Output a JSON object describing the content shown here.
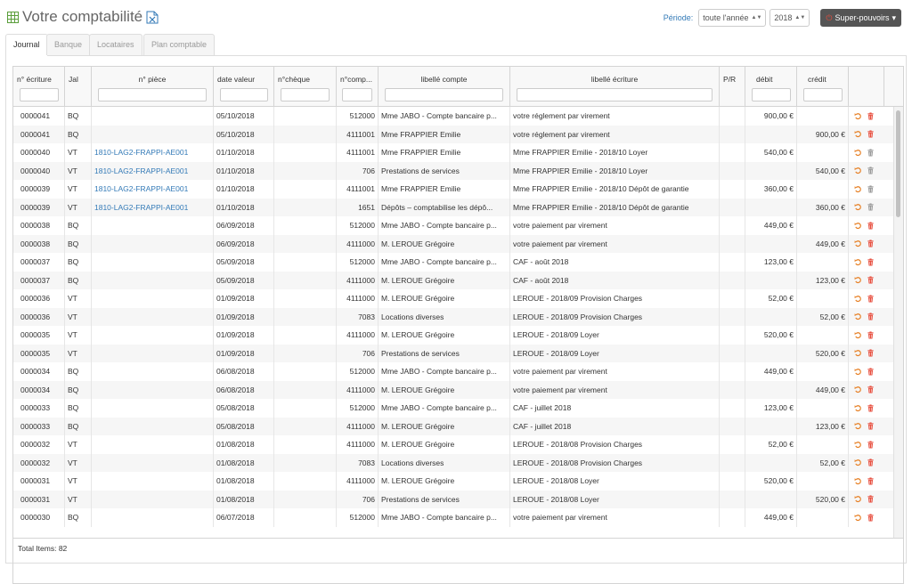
{
  "page": {
    "title": "Votre comptabilité"
  },
  "period": {
    "label": "Période:",
    "range": "toute l'année",
    "year": "2018"
  },
  "super": {
    "label": "Super-pouvoirs"
  },
  "tabs": [
    {
      "label": "Journal",
      "active": true
    },
    {
      "label": "Banque",
      "active": false
    },
    {
      "label": "Locataires",
      "active": false
    },
    {
      "label": "Plan comptable",
      "active": false
    }
  ],
  "columns": [
    "n° écriture",
    "Jal",
    "n° pièce",
    "date valeur",
    "n°chèque",
    "n°comp...",
    "libellé compte",
    "libellé écriture",
    "P/R",
    "débit",
    "crédit"
  ],
  "rows": [
    {
      "ecriture": "0000041",
      "jal": "BQ",
      "piece": "",
      "date": "05/10/2018",
      "cheque": "",
      "compte": "512000",
      "libcompte": "Mme JABO - Compte bancaire p...",
      "libecriture": "votre réglement par virement",
      "pr": "",
      "debit": "900,00 €",
      "credit": ""
    },
    {
      "ecriture": "0000041",
      "jal": "BQ",
      "piece": "",
      "date": "05/10/2018",
      "cheque": "",
      "compte": "4111001",
      "libcompte": "Mme FRAPPIER Emilie",
      "libecriture": "votre réglement par virement",
      "pr": "",
      "debit": "",
      "credit": "900,00 €"
    },
    {
      "ecriture": "0000040",
      "jal": "VT",
      "piece": "1810-LAG2-FRAPPI-AE001",
      "date": "01/10/2018",
      "cheque": "",
      "compte": "4111001",
      "libcompte": "Mme FRAPPIER Emilie",
      "libecriture": "Mme FRAPPIER Emilie - 2018/10 Loyer",
      "pr": "",
      "debit": "540,00 €",
      "credit": ""
    },
    {
      "ecriture": "0000040",
      "jal": "VT",
      "piece": "1810-LAG2-FRAPPI-AE001",
      "date": "01/10/2018",
      "cheque": "",
      "compte": "706",
      "libcompte": "Prestations de services",
      "libecriture": "Mme FRAPPIER Emilie - 2018/10 Loyer",
      "pr": "",
      "debit": "",
      "credit": "540,00 €"
    },
    {
      "ecriture": "0000039",
      "jal": "VT",
      "piece": "1810-LAG2-FRAPPI-AE001",
      "date": "01/10/2018",
      "cheque": "",
      "compte": "4111001",
      "libcompte": "Mme FRAPPIER Emilie",
      "libecriture": "Mme FRAPPIER Emilie - 2018/10 Dépôt de garantie",
      "pr": "",
      "debit": "360,00 €",
      "credit": ""
    },
    {
      "ecriture": "0000039",
      "jal": "VT",
      "piece": "1810-LAG2-FRAPPI-AE001",
      "date": "01/10/2018",
      "cheque": "",
      "compte": "1651",
      "libcompte": "Dépôts – comptabilise les dépô...",
      "libecriture": "Mme FRAPPIER Emilie - 2018/10 Dépôt de garantie",
      "pr": "",
      "debit": "",
      "credit": "360,00 €"
    },
    {
      "ecriture": "0000038",
      "jal": "BQ",
      "piece": "",
      "date": "06/09/2018",
      "cheque": "",
      "compte": "512000",
      "libcompte": "Mme JABO - Compte bancaire p...",
      "libecriture": "votre paiement par virement",
      "pr": "",
      "debit": "449,00 €",
      "credit": ""
    },
    {
      "ecriture": "0000038",
      "jal": "BQ",
      "piece": "",
      "date": "06/09/2018",
      "cheque": "",
      "compte": "4111000",
      "libcompte": "M. LEROUE Grégoire",
      "libecriture": "votre paiement par virement",
      "pr": "",
      "debit": "",
      "credit": "449,00 €"
    },
    {
      "ecriture": "0000037",
      "jal": "BQ",
      "piece": "",
      "date": "05/09/2018",
      "cheque": "",
      "compte": "512000",
      "libcompte": "Mme JABO - Compte bancaire p...",
      "libecriture": "CAF - août 2018",
      "pr": "",
      "debit": "123,00 €",
      "credit": ""
    },
    {
      "ecriture": "0000037",
      "jal": "BQ",
      "piece": "",
      "date": "05/09/2018",
      "cheque": "",
      "compte": "4111000",
      "libcompte": "M. LEROUE Grégoire",
      "libecriture": "CAF - août 2018",
      "pr": "",
      "debit": "",
      "credit": "123,00 €"
    },
    {
      "ecriture": "0000036",
      "jal": "VT",
      "piece": "",
      "date": "01/09/2018",
      "cheque": "",
      "compte": "4111000",
      "libcompte": "M. LEROUE Grégoire",
      "libecriture": "LEROUE - 2018/09 Provision Charges",
      "pr": "",
      "debit": "52,00 €",
      "credit": ""
    },
    {
      "ecriture": "0000036",
      "jal": "VT",
      "piece": "",
      "date": "01/09/2018",
      "cheque": "",
      "compte": "7083",
      "libcompte": "Locations diverses",
      "libecriture": "LEROUE - 2018/09 Provision Charges",
      "pr": "",
      "debit": "",
      "credit": "52,00 €"
    },
    {
      "ecriture": "0000035",
      "jal": "VT",
      "piece": "",
      "date": "01/09/2018",
      "cheque": "",
      "compte": "4111000",
      "libcompte": "M. LEROUE Grégoire",
      "libecriture": "LEROUE - 2018/09 Loyer",
      "pr": "",
      "debit": "520,00 €",
      "credit": ""
    },
    {
      "ecriture": "0000035",
      "jal": "VT",
      "piece": "",
      "date": "01/09/2018",
      "cheque": "",
      "compte": "706",
      "libcompte": "Prestations de services",
      "libecriture": "LEROUE - 2018/09 Loyer",
      "pr": "",
      "debit": "",
      "credit": "520,00 €"
    },
    {
      "ecriture": "0000034",
      "jal": "BQ",
      "piece": "",
      "date": "06/08/2018",
      "cheque": "",
      "compte": "512000",
      "libcompte": "Mme JABO - Compte bancaire p...",
      "libecriture": "votre paiement par virement",
      "pr": "",
      "debit": "449,00 €",
      "credit": ""
    },
    {
      "ecriture": "0000034",
      "jal": "BQ",
      "piece": "",
      "date": "06/08/2018",
      "cheque": "",
      "compte": "4111000",
      "libcompte": "M. LEROUE Grégoire",
      "libecriture": "votre paiement par virement",
      "pr": "",
      "debit": "",
      "credit": "449,00 €"
    },
    {
      "ecriture": "0000033",
      "jal": "BQ",
      "piece": "",
      "date": "05/08/2018",
      "cheque": "",
      "compte": "512000",
      "libcompte": "Mme JABO - Compte bancaire p...",
      "libecriture": "CAF - juillet 2018",
      "pr": "",
      "debit": "123,00 €",
      "credit": ""
    },
    {
      "ecriture": "0000033",
      "jal": "BQ",
      "piece": "",
      "date": "05/08/2018",
      "cheque": "",
      "compte": "4111000",
      "libcompte": "M. LEROUE Grégoire",
      "libecriture": "CAF - juillet 2018",
      "pr": "",
      "debit": "",
      "credit": "123,00 €"
    },
    {
      "ecriture": "0000032",
      "jal": "VT",
      "piece": "",
      "date": "01/08/2018",
      "cheque": "",
      "compte": "4111000",
      "libcompte": "M. LEROUE Grégoire",
      "libecriture": "LEROUE - 2018/08 Provision Charges",
      "pr": "",
      "debit": "52,00 €",
      "credit": ""
    },
    {
      "ecriture": "0000032",
      "jal": "VT",
      "piece": "",
      "date": "01/08/2018",
      "cheque": "",
      "compte": "7083",
      "libcompte": "Locations diverses",
      "libecriture": "LEROUE - 2018/08 Provision Charges",
      "pr": "",
      "debit": "",
      "credit": "52,00 €"
    },
    {
      "ecriture": "0000031",
      "jal": "VT",
      "piece": "",
      "date": "01/08/2018",
      "cheque": "",
      "compte": "4111000",
      "libcompte": "M. LEROUE Grégoire",
      "libecriture": "LEROUE - 2018/08 Loyer",
      "pr": "",
      "debit": "520,00 €",
      "credit": ""
    },
    {
      "ecriture": "0000031",
      "jal": "VT",
      "piece": "",
      "date": "01/08/2018",
      "cheque": "",
      "compte": "706",
      "libcompte": "Prestations de services",
      "libecriture": "LEROUE - 2018/08 Loyer",
      "pr": "",
      "debit": "",
      "credit": "520,00 €"
    },
    {
      "ecriture": "0000030",
      "jal": "BQ",
      "piece": "",
      "date": "06/07/2018",
      "cheque": "",
      "compte": "512000",
      "libcompte": "Mme JABO - Compte bancaire p...",
      "libecriture": "votre paiement par virement",
      "pr": "",
      "debit": "449,00 €",
      "credit": ""
    }
  ],
  "footer": {
    "total": "Total Items: 82"
  },
  "colors": {
    "accent": "#337ab7",
    "super_bg": "#555555",
    "undo": "#e67e22",
    "delete": "#e74c3c",
    "delete_grey": "#999999"
  },
  "icons": {
    "title": "spreadsheet-grid-icon",
    "export": "excel-export-icon",
    "undo": "undo-icon",
    "delete": "trash-icon",
    "super": "power-icon"
  }
}
